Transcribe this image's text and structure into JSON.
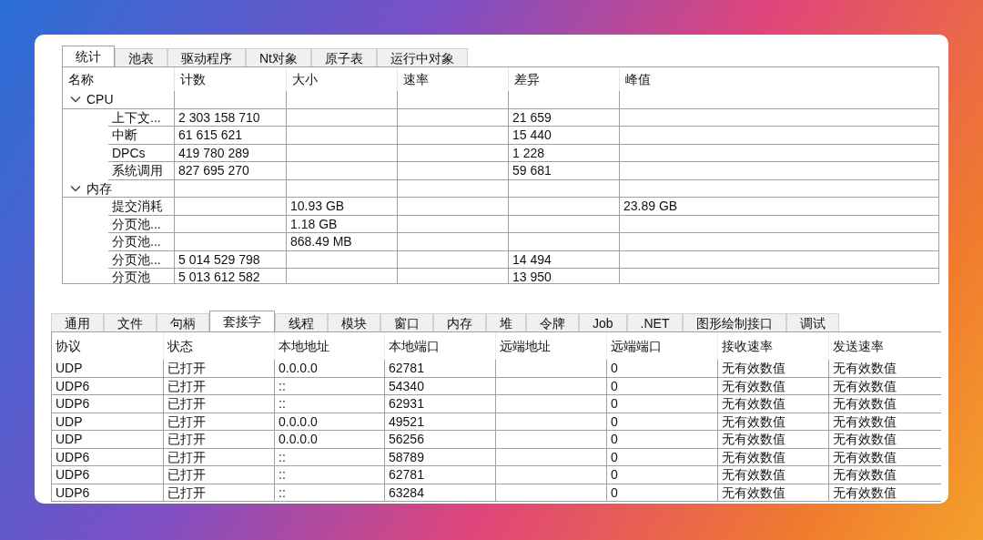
{
  "top_tabs": [
    {
      "label": "统计",
      "selected": true
    },
    {
      "label": "池表",
      "selected": false
    },
    {
      "label": "驱动程序",
      "selected": false
    },
    {
      "label": "Nt对象",
      "selected": false
    },
    {
      "label": "原子表",
      "selected": false
    },
    {
      "label": "运行中对象",
      "selected": false
    }
  ],
  "stats_table": {
    "columns": [
      "名称",
      "计数",
      "大小",
      "速率",
      "差异",
      "峰值"
    ],
    "rows": [
      {
        "name": "CPU",
        "expanded": true,
        "cells": [
          "",
          "",
          "",
          "",
          ""
        ],
        "children": [
          {
            "name": "上下文...",
            "cells": [
              "2 303 158 710",
              "",
              "",
              "21 659",
              ""
            ]
          },
          {
            "name": "中断",
            "cells": [
              "61 615 621",
              "",
              "",
              "15 440",
              ""
            ]
          },
          {
            "name": "DPCs",
            "cells": [
              "419 780 289",
              "",
              "",
              "1 228",
              ""
            ]
          },
          {
            "name": "系统调用",
            "cells": [
              "827 695 270",
              "",
              "",
              "59 681",
              ""
            ]
          }
        ]
      },
      {
        "name": "内存",
        "expanded": true,
        "cells": [
          "",
          "",
          "",
          "",
          ""
        ],
        "children": [
          {
            "name": "提交消耗",
            "cells": [
              "",
              "10.93 GB",
              "",
              "",
              "23.89 GB"
            ]
          },
          {
            "name": "分页池...",
            "cells": [
              "",
              "1.18 GB",
              "",
              "",
              ""
            ]
          },
          {
            "name": "分页池...",
            "cells": [
              "",
              "868.49 MB",
              "",
              "",
              ""
            ]
          },
          {
            "name": "分页池...",
            "cells": [
              "5 014 529 798",
              "",
              "",
              "14 494",
              ""
            ]
          },
          {
            "name": "分页池",
            "cells": [
              "5 013 612 582",
              "",
              "",
              "13 950",
              ""
            ]
          }
        ]
      }
    ]
  },
  "bottom_tabs": [
    {
      "label": "通用",
      "selected": false
    },
    {
      "label": "文件",
      "selected": false
    },
    {
      "label": "句柄",
      "selected": false
    },
    {
      "label": "套接字",
      "selected": true
    },
    {
      "label": "线程",
      "selected": false
    },
    {
      "label": "模块",
      "selected": false
    },
    {
      "label": "窗口",
      "selected": false
    },
    {
      "label": "内存",
      "selected": false
    },
    {
      "label": "堆",
      "selected": false
    },
    {
      "label": "令牌",
      "selected": false
    },
    {
      "label": "Job",
      "selected": false
    },
    {
      "label": ".NET",
      "selected": false
    },
    {
      "label": "图形绘制接口",
      "selected": false
    },
    {
      "label": "调试",
      "selected": false
    }
  ],
  "sockets_table": {
    "columns": [
      "协议",
      "状态",
      "本地地址",
      "本地端口",
      "远端地址",
      "远端端口",
      "接收速率",
      "发送速率"
    ],
    "rows": [
      [
        "UDP",
        "已打开",
        "0.0.0.0",
        "62781",
        "",
        "0",
        "无有效数值",
        "无有效数值"
      ],
      [
        "UDP6",
        "已打开",
        "::",
        "54340",
        "",
        "0",
        "无有效数值",
        "无有效数值"
      ],
      [
        "UDP6",
        "已打开",
        "::",
        "62931",
        "",
        "0",
        "无有效数值",
        "无有效数值"
      ],
      [
        "UDP",
        "已打开",
        "0.0.0.0",
        "49521",
        "",
        "0",
        "无有效数值",
        "无有效数值"
      ],
      [
        "UDP",
        "已打开",
        "0.0.0.0",
        "56256",
        "",
        "0",
        "无有效数值",
        "无有效数值"
      ],
      [
        "UDP6",
        "已打开",
        "::",
        "58789",
        "",
        "0",
        "无有效数值",
        "无有效数值"
      ],
      [
        "UDP6",
        "已打开",
        "::",
        "62781",
        "",
        "0",
        "无有效数值",
        "无有效数值"
      ],
      [
        "UDP6",
        "已打开",
        "::",
        "63284",
        "",
        "0",
        "无有效数值",
        "无有效数值"
      ]
    ]
  }
}
